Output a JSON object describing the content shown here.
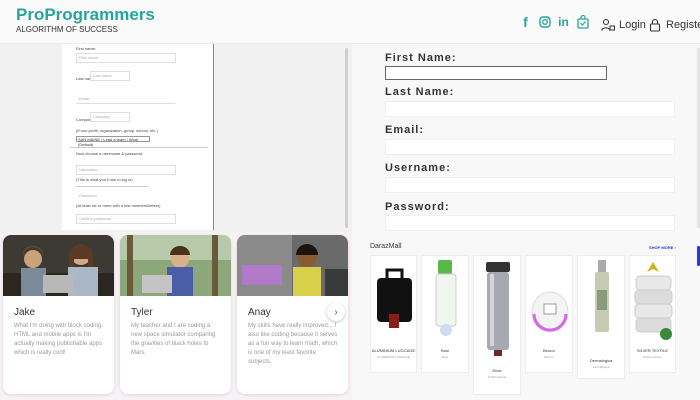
{
  "header": {
    "brand": "ProProgrammers",
    "tagline": "ALGORITHM OF SUCCESS",
    "social_icons": [
      "facebook-icon",
      "instagram-icon",
      "linkedin-icon",
      "shop-bag-icon"
    ],
    "login_label": "Login",
    "register_label": "Register"
  },
  "form_preview": {
    "first_name_label": "First name:",
    "first_name_placeholder": "First name",
    "last_name_label": "Last name:",
    "last_name_placeholder": "Last name",
    "email_placeholder": "Email",
    "company_label": "Company:",
    "company_placeholder": "Company",
    "company_note": "(If non-profit, organization, group, school, etc.)",
    "select_value": "SAN MAINE / Lead a team / Work (Default)",
    "credentials_note": "Now choose a username & password",
    "username_placeholder": "Username",
    "username_note": "(This is what you'll use to log in)",
    "password_placeholder": "Password",
    "password_note": "(At least six or more with a few numbers/letters)",
    "confirm_placeholder": "Confirm password"
  },
  "stories": [
    {
      "name": "Jake",
      "text": "What I'm doing with block coding, HTML and mobile apps is I'm actually making publishable apps which is really cool!"
    },
    {
      "name": "Tyler",
      "text": "My teacher and I are coding a new space simulator comparing the gravities of black holes to Mars."
    },
    {
      "name": "Anay",
      "text": "My skills have really improved... I also like coding because it serves as a fun way to learn math, which is one of my least favorite subjects."
    }
  ],
  "carousel": {
    "next_label": "›"
  },
  "signup": {
    "first_name": "First Name:",
    "last_name": "Last Name:",
    "email": "Email:",
    "username": "Username:",
    "password": "Password:"
  },
  "shelf": {
    "title": "DarazMall",
    "shop_more": "SHOP MORE ›",
    "products": [
      {
        "title": "ALUMINIUM LUGGAGE",
        "sub": "ALUMINIUM LUGGAGE"
      },
      {
        "title": "Bosi",
        "sub": "Bosi"
      },
      {
        "title": "Zilver",
        "sub": "Public Kansai"
      },
      {
        "title": "Beuror",
        "sub": "Beuror"
      },
      {
        "title": "Dermalogica",
        "sub": "Dermalogica"
      },
      {
        "title": "SILVER TEXTILE",
        "sub": "Textile Factory"
      }
    ]
  },
  "colors": {
    "brand": "#26a69a",
    "shop_more": "#1e3cd8"
  }
}
